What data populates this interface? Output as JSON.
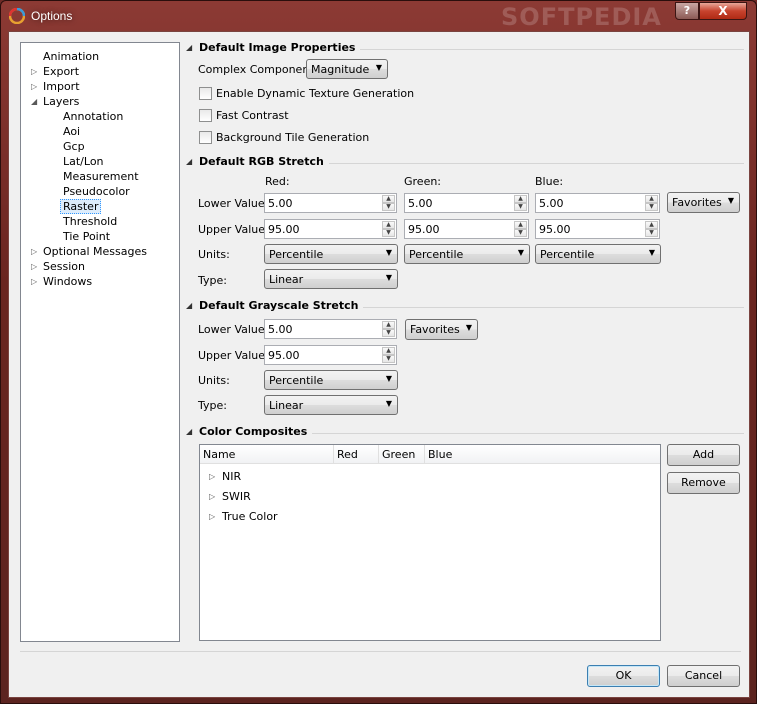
{
  "window": {
    "title": "Options",
    "watermark": "SOFTPEDIA",
    "help_label": "?",
    "close_label": "X"
  },
  "tree": {
    "items": [
      {
        "label": "Animation",
        "expandable": false,
        "level": 0
      },
      {
        "label": "Export",
        "expandable": true,
        "expanded": false,
        "level": 0
      },
      {
        "label": "Import",
        "expandable": true,
        "expanded": false,
        "level": 0
      },
      {
        "label": "Layers",
        "expandable": true,
        "expanded": true,
        "level": 0
      },
      {
        "label": "Annotation",
        "level": 1
      },
      {
        "label": "Aoi",
        "level": 1
      },
      {
        "label": "Gcp",
        "level": 1
      },
      {
        "label": "Lat/Lon",
        "level": 1
      },
      {
        "label": "Measurement",
        "level": 1
      },
      {
        "label": "Pseudocolor",
        "level": 1
      },
      {
        "label": "Raster",
        "level": 1,
        "selected": true
      },
      {
        "label": "Threshold",
        "level": 1
      },
      {
        "label": "Tie Point",
        "level": 1
      },
      {
        "label": "Optional Messages",
        "expandable": true,
        "expanded": false,
        "level": 0
      },
      {
        "label": "Session",
        "expandable": true,
        "expanded": false,
        "level": 0
      },
      {
        "label": "Windows",
        "expandable": true,
        "expanded": false,
        "level": 0
      }
    ]
  },
  "image_props": {
    "title": "Default Image Properties",
    "complex_label": "Complex Component:",
    "complex_value": "Magnitude",
    "dynamic_texture": "Enable Dynamic Texture Generation",
    "fast_contrast": "Fast Contrast",
    "background_tile": "Background Tile Generation"
  },
  "rgb": {
    "title": "Default RGB Stretch",
    "red_header": "Red:",
    "green_header": "Green:",
    "blue_header": "Blue:",
    "lower_label": "Lower Value:",
    "upper_label": "Upper Value:",
    "units_label": "Units:",
    "type_label": "Type:",
    "red_lower": "5.00",
    "green_lower": "5.00",
    "blue_lower": "5.00",
    "red_upper": "95.00",
    "green_upper": "95.00",
    "blue_upper": "95.00",
    "red_units": "Percentile",
    "green_units": "Percentile",
    "blue_units": "Percentile",
    "type_value": "Linear",
    "favorites": "Favorites"
  },
  "gray": {
    "title": "Default Grayscale Stretch",
    "lower_label": "Lower Value:",
    "upper_label": "Upper Value:",
    "units_label": "Units:",
    "type_label": "Type:",
    "lower_value": "5.00",
    "upper_value": "95.00",
    "units_value": "Percentile",
    "type_value": "Linear",
    "favorites": "Favorites"
  },
  "composites": {
    "title": "Color Composites",
    "columns": [
      "Name",
      "Red",
      "Green",
      "Blue"
    ],
    "rows": [
      "NIR",
      "SWIR",
      "True Color"
    ],
    "add": "Add",
    "remove": "Remove"
  },
  "footer": {
    "ok": "OK",
    "cancel": "Cancel"
  }
}
